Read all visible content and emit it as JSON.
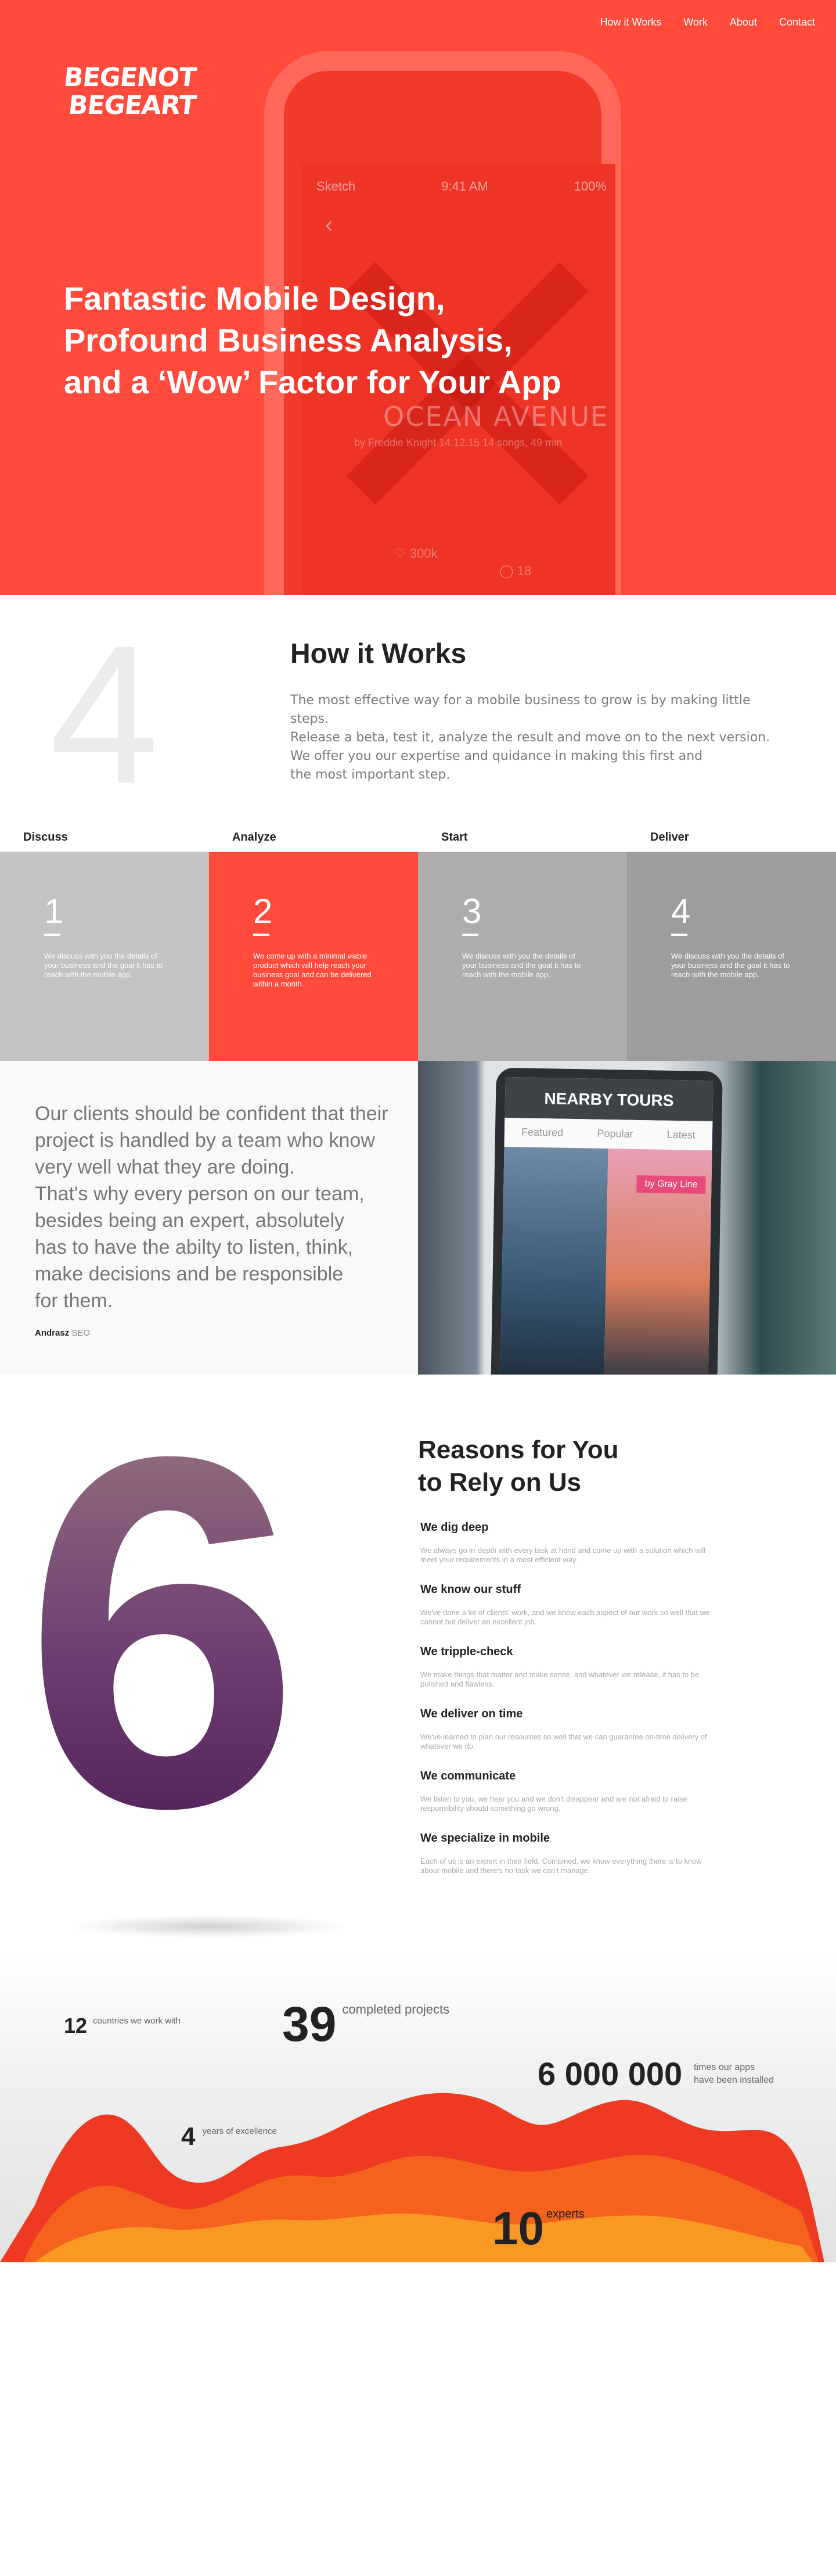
{
  "nav": {
    "items": [
      {
        "label": "How it Works"
      },
      {
        "label": "Work"
      },
      {
        "label": "About"
      },
      {
        "label": "Contact"
      }
    ]
  },
  "hero": {
    "logo_line1": "BEGENOT",
    "logo_line2": "BEGEART",
    "title_lines": [
      "Fantastic Mobile Design,",
      "Profound Business Analysis,",
      "and a ‘Wow’ Factor for Your App"
    ],
    "phone": {
      "carrier": "Sketch",
      "time": "9:41 AM",
      "battery": "100%",
      "album": "OCEAN AVENUE",
      "byline": "by Freddie Knight    14.12.15    14 songs, 49 min",
      "likes": "300k",
      "comments": "18"
    }
  },
  "how": {
    "big_number": "4",
    "title": "How it Works",
    "text_lines": [
      "The most effective way for a mobile business to grow is by making little steps.",
      "Release a beta, test it, analyze the result and move on to the next version.",
      "We offer you our expertise and quidance in  making this first and",
      "the most important step."
    ],
    "steps": [
      {
        "label": "Discuss",
        "num": "1",
        "text": "We discuss with you the details of your business and the goal it has to reach with the mobile app."
      },
      {
        "label": "Analyze",
        "num": "2",
        "text": "We come up with a minimal viable product which will help reach your business goal and can be delivered within a month."
      },
      {
        "label": "Start",
        "num": "3",
        "text": "We discuss with you the details of your business and the goal it has to reach with the mobile app."
      },
      {
        "label": "Deliver",
        "num": "4",
        "text": "We discuss with you the details of your business and the goal it has to reach with the mobile app."
      }
    ]
  },
  "quote": {
    "lines": [
      "Our clients should be confident that their",
      "project is handled by a team who know",
      "very well what they are doing.",
      "That's why every person on our team,",
      "besides being an expert, absolutely",
      "has to have the abilty to listen, think,",
      "make decisions and be responsible",
      "for them."
    ],
    "author": "Andrasz",
    "role": "SEO",
    "app": {
      "title": "NEARBY TOURS",
      "tab1": "Popular",
      "tab2": "Latest",
      "tab3": "Featured",
      "tag": "by Gray Line"
    }
  },
  "reasons": {
    "big_number": "6",
    "title_line1": "Reasons for You",
    "title_line2": "to Rely on Us",
    "items": [
      {
        "title": "We dig deep",
        "text": "We always go in-depth with every task at hand and come up with a solution which will meet your requirements in a most efficient way."
      },
      {
        "title": "We know our stuff",
        "text": "We've done a lot of clients' work, and we know each aspect of our work so well that we cannot but deliver an excellent job."
      },
      {
        "title": "We tripple-check",
        "text": "We make things that matter and make sense, and whatever we release, it has to be polished and flawless."
      },
      {
        "title": "We deliver on time",
        "text": "We've learned to plan our resources so well that we can guarantee on-time delivery of whatever we do."
      },
      {
        "title": "We communicate",
        "text": "We listen to you, we hear you and we don't disappear and are not afraid to raise responsibility should something go wrong."
      },
      {
        "title": "We specialize in mobile",
        "text": "Each of us is an expert in their field. Combined, we know everything there is to know about mobile and there's no task we can't manage."
      }
    ]
  },
  "stats": {
    "countries_num": "12",
    "countries_label": "countries we work with",
    "projects_num": "39",
    "projects_label": "completed projects",
    "installs_num": "6 000 000",
    "installs_label1": "times our apps",
    "installs_label2": "have been installed",
    "years_num": "4",
    "years_label": "years of excellence",
    "experts_num": "10",
    "experts_label": "experts"
  },
  "colors": {
    "brand": "#ff4a3c",
    "hero_bg": "#ff4a3c",
    "step_gray1": "#c3c3c3",
    "step_gray2": "#adadad",
    "step_gray3": "#9d9d9d",
    "six_top": "#9a7880",
    "six_bottom": "#4a1a52"
  }
}
